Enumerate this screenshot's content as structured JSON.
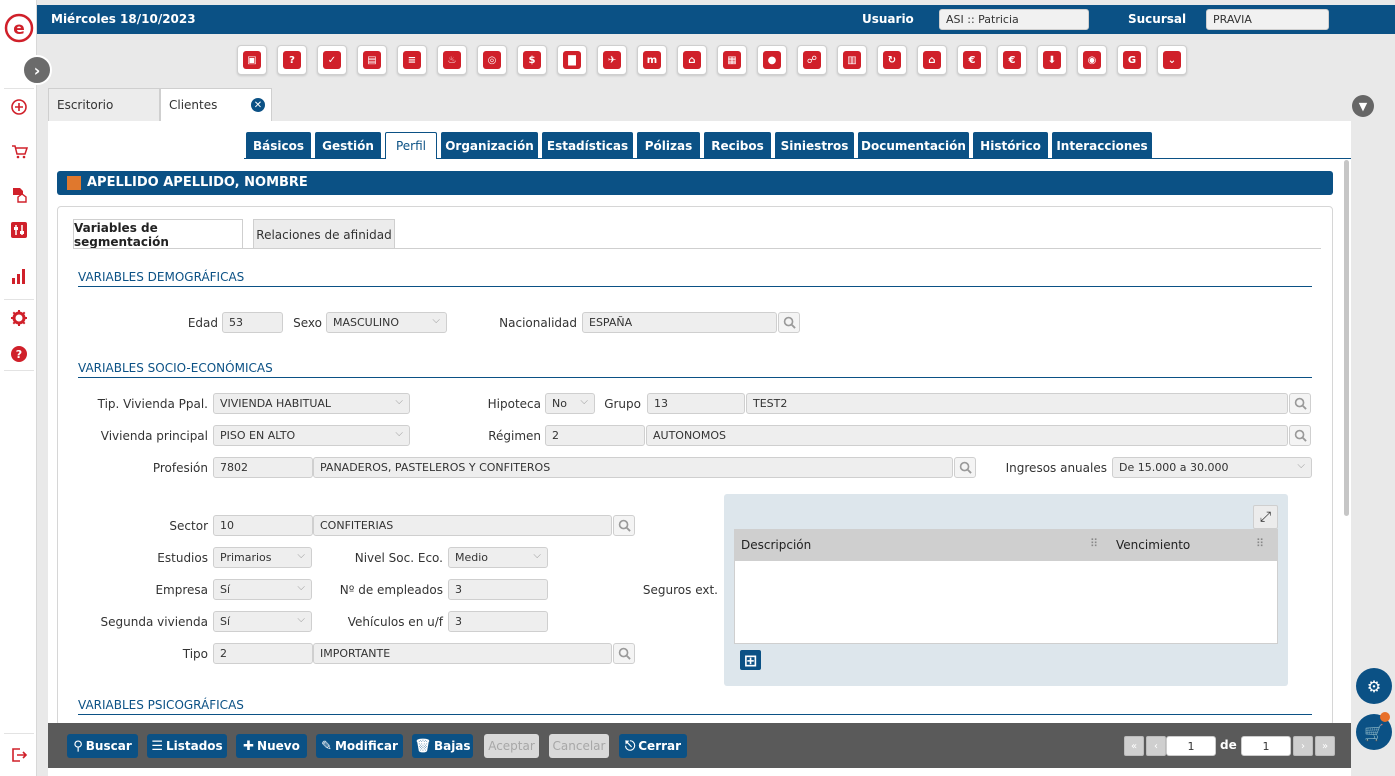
{
  "topbar": {
    "date": "Miércoles 18/10/2023",
    "user_label": "Usuario",
    "user_value": "ASI :: Patricia",
    "branch_label": "Sucursal",
    "branch_value": "PRAVIA"
  },
  "rail_icons": [
    "plus-circle-icon",
    "cart-icon",
    "document-house-icon",
    "sliders-icon",
    "bar-chart-icon",
    "gear-icon",
    "help-icon",
    "logout-icon"
  ],
  "module_icons": [
    "cube-icon",
    "user-question-icon",
    "user-check-icon",
    "document-icon",
    "list-icon",
    "flame-icon",
    "target-icon",
    "money-icon",
    "briefcase-icon",
    "bag-icon",
    "chart-m-icon",
    "house-icon",
    "building-icon",
    "person-icon",
    "group-icon",
    "buildings-icon",
    "cycle-icon",
    "user-home-icon",
    "euro-icon",
    "euro-house-icon",
    "shield-down-icon",
    "eye-icon",
    "g-logo-icon",
    "chevron-down-icon"
  ],
  "window_tabs": {
    "escritorio": "Escritorio",
    "clientes": "Clientes"
  },
  "section_tabs": [
    "Básicos",
    "Gestión",
    "Perfil",
    "Organización",
    "Estadísticas",
    "Pólizas",
    "Recibos",
    "Siniestros",
    "Documentación",
    "Histórico",
    "Interacciones"
  ],
  "active_section": "Perfil",
  "client": {
    "name": "APELLIDO APELLIDO, NOMBRE",
    "color": "#e0782d"
  },
  "subtabs": [
    "Variables de segmentación",
    "Relaciones de afinidad"
  ],
  "demograficas": {
    "title": "VARIABLES DEMOGRÁFICAS",
    "edad_label": "Edad",
    "edad": "53",
    "sexo_label": "Sexo",
    "sexo": "MASCULINO",
    "nacionalidad_label": "Nacionalidad",
    "nacionalidad": "ESPAÑA"
  },
  "socio": {
    "title": "VARIABLES SOCIO-ECONÓMICAS",
    "tip_vivienda_label": "Tip. Vivienda Ppal.",
    "tip_vivienda": "VIVIENDA HABITUAL",
    "hipoteca_label": "Hipoteca",
    "hipoteca": "No",
    "grupo_label": "Grupo",
    "grupo_code": "13",
    "grupo_desc": "TEST2",
    "vivienda_label": "Vivienda principal",
    "vivienda": "PISO EN ALTO",
    "regimen_label": "Régimen",
    "regimen_code": "2",
    "regimen_desc": "AUTONOMOS",
    "profesion_label": "Profesión",
    "profesion_code": "7802",
    "profesion_desc": "PANADEROS, PASTELEROS Y CONFITEROS",
    "ingresos_label": "Ingresos anuales",
    "ingresos": "De 15.000 a 30.000",
    "sector_label": "Sector",
    "sector_code": "10",
    "sector_desc": "CONFITERIAS",
    "estudios_label": "Estudios",
    "estudios": "Primarios",
    "nivel_label": "Nivel Soc. Eco.",
    "nivel": "Medio",
    "empresa_label": "Empresa",
    "empresa": "Sí",
    "empleados_label": "Nº de empleados",
    "empleados": "3",
    "segunda_label": "Segunda vivienda",
    "segunda": "Sí",
    "vehiculos_label": "Vehículos en u/f",
    "vehiculos": "3",
    "tipo_label": "Tipo",
    "tipo_code": "2",
    "tipo_desc": "IMPORTANTE",
    "seguros_label": "Seguros ext.",
    "seguros_cols": [
      "Descripción",
      "Vencimiento"
    ]
  },
  "psico": {
    "title": "VARIABLES PSICOGRÁFICAS"
  },
  "actions": {
    "buscar": "Buscar",
    "listados": "Listados",
    "nuevo": "Nuevo",
    "modificar": "Modificar",
    "bajas": "Bajas",
    "aceptar": "Aceptar",
    "cancelar": "Cancelar",
    "cerrar": "Cerrar"
  },
  "pager": {
    "page": "1",
    "of_label": "de",
    "total": "1"
  }
}
